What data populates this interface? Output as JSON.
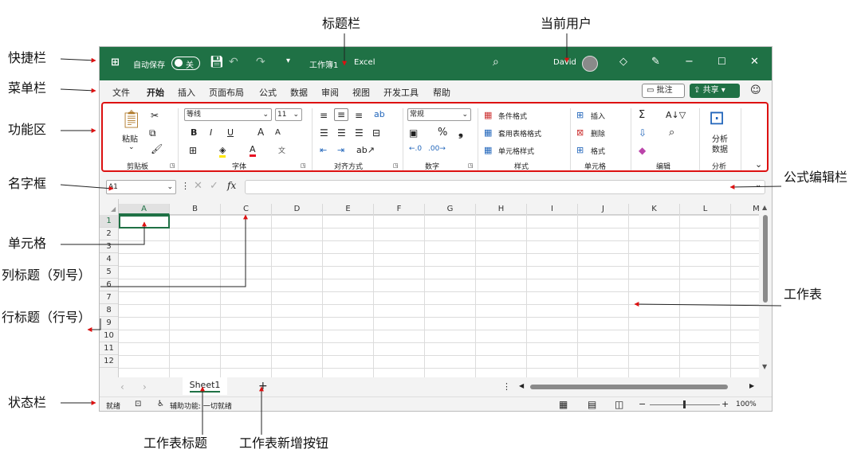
{
  "annotations": {
    "title_bar": "标题栏",
    "current_user": "当前用户",
    "quick_access": "快捷栏",
    "menu_bar": "菜单栏",
    "ribbon": "功能区",
    "name_box": "名字框",
    "formula_bar": "公式编辑栏",
    "cell": "单元格",
    "col_header": "列标题（列号）",
    "row_header": "行标题（行号）",
    "worksheet": "工作表",
    "status_bar": "状态栏",
    "sheet_tab": "工作表标题",
    "new_sheet_btn": "工作表新增按钮"
  },
  "titlebar": {
    "autosave": "自动保存",
    "toggle": "关",
    "doc_title": "工作簿1",
    "dash": "-",
    "app": "Excel",
    "user": "David"
  },
  "menu": [
    "文件",
    "开始",
    "插入",
    "页面布局",
    "公式",
    "数据",
    "审阅",
    "视图",
    "开发工具",
    "帮助"
  ],
  "menu_right": {
    "comment": "批注",
    "share": "共享"
  },
  "ribbon": {
    "clipboard": {
      "paste": "粘贴",
      "group": "剪贴板"
    },
    "font": {
      "name": "等线",
      "size": "11",
      "bold": "B",
      "italic": "I",
      "underline": "U",
      "grow": "A",
      "shrink": "A",
      "group": "字体",
      "color_font": "#e81123",
      "color_fill": "#ffe600"
    },
    "align": {
      "group": "对齐方式"
    },
    "number": {
      "format": "常规",
      "percent": "%",
      "group": "数字"
    },
    "styles": {
      "cond": "条件格式",
      "table": "套用表格格式",
      "cell": "单元格样式",
      "group": "样式"
    },
    "cells": {
      "insert": "插入",
      "delete": "删除",
      "format": "格式",
      "group": "单元格"
    },
    "edit": {
      "group": "编辑"
    },
    "analysis": {
      "line1": "分析",
      "line2": "数据",
      "group": "分析"
    }
  },
  "formula": {
    "name_box": "A1",
    "fx": "fx"
  },
  "columns": [
    "A",
    "B",
    "C",
    "D",
    "E",
    "F",
    "G",
    "H",
    "I",
    "J",
    "K",
    "L",
    "M"
  ],
  "rows": [
    "1",
    "2",
    "3",
    "4",
    "5",
    "6",
    "7",
    "8",
    "9",
    "10",
    "11",
    "12"
  ],
  "tabs": {
    "sheet": "Sheet1",
    "add": "+"
  },
  "status": {
    "ready": "就绪",
    "accessibility": "辅助功能: 一切就绪",
    "zoom": "100%"
  },
  "colors": {
    "excel_green": "#1f7145",
    "arrow_red": "#d11"
  }
}
